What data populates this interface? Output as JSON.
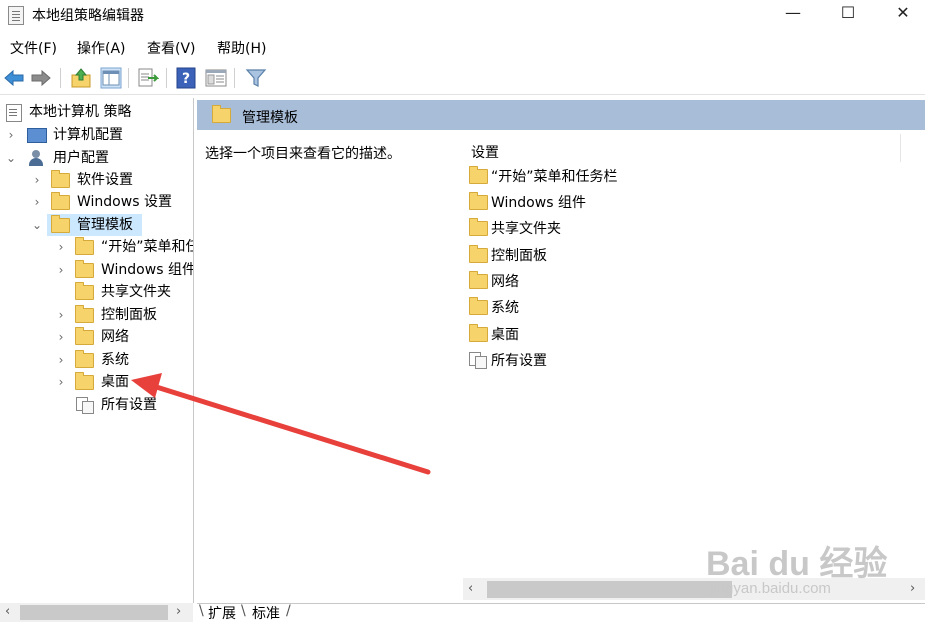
{
  "window": {
    "title": "本地组策略编辑器",
    "min_glyph": "—",
    "max_glyph": "☐",
    "close_glyph": "✕"
  },
  "menu": [
    "文件(F)",
    "操作(A)",
    "查看(V)",
    "帮助(H)"
  ],
  "toolbar": {
    "icons": [
      "back-icon",
      "forward-icon",
      "up-folder-icon",
      "show-hide-tree-icon",
      "export-list-icon",
      "help-icon",
      "properties-icon",
      "filter-icon"
    ]
  },
  "tree": {
    "root": "本地计算机 策略",
    "computer_config": "计算机配置",
    "user_config": "用户配置",
    "software_settings": "软件设置",
    "windows_settings": "Windows 设置",
    "admin_templates": "管理模板",
    "children": [
      "“开始”菜单和任",
      "Windows 组件",
      "共享文件夹",
      "控制面板",
      "网络",
      "系统",
      "桌面"
    ],
    "all_settings": "所有设置"
  },
  "right_pane": {
    "header": "管理模板",
    "description": "选择一个项目来查看它的描述。",
    "column_header": "设置",
    "items": [
      "“开始”菜单和任务栏",
      "Windows 组件",
      "共享文件夹",
      "控制面板",
      "网络",
      "系统",
      "桌面"
    ],
    "all_settings": "所有设置"
  },
  "tabs": [
    "扩展",
    "标准"
  ],
  "watermark": {
    "main": "Bai du 经验",
    "sub": "jingyan.baidu.com"
  },
  "colors": {
    "header_blue": "#a8bdd8",
    "selection": "#cce8ff",
    "folder_yellow": "#f6d36b",
    "annotation_arrow": "#e8413c"
  }
}
